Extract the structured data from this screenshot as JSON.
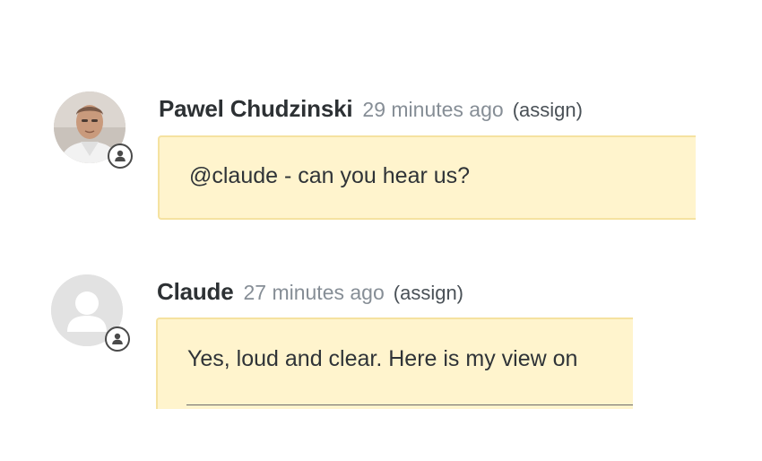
{
  "comments": [
    {
      "author": "Pawel Chudzinski",
      "time": "29 minutes ago",
      "assign_label": "(assign)",
      "body": "@claude - can you hear us?",
      "avatar": "user-photo",
      "badge_icon": "person-icon"
    },
    {
      "author": "Claude",
      "time": "27 minutes ago",
      "assign_label": "(assign)",
      "body": "Yes, loud and clear. Here is my view on",
      "avatar": "default-person-avatar",
      "badge_icon": "person-icon"
    }
  ],
  "colors": {
    "bubble_bg": "#fff4cd",
    "bubble_border": "#f5e2a0",
    "timestamp": "#868e96"
  }
}
